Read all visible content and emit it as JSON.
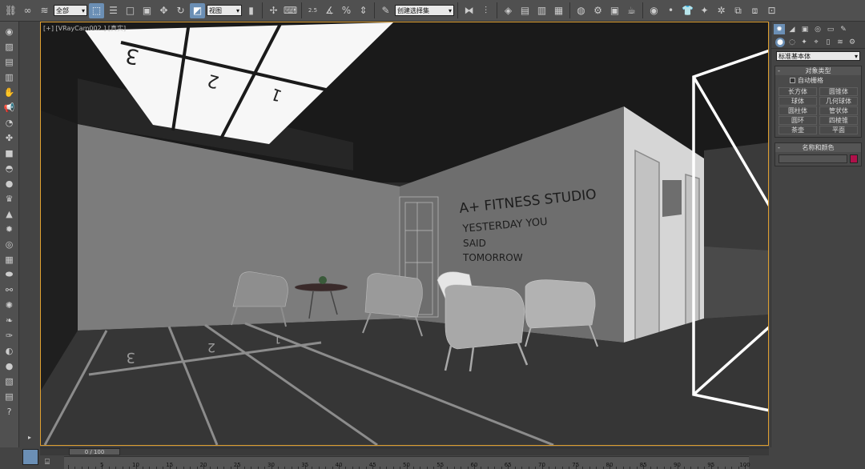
{
  "toolbar": {
    "selection_filter": "全部",
    "reference_coord": "视图",
    "named_selection": "创建选择集",
    "snap_25": "2.5",
    "percent_snap": "%",
    "icons": [
      "link-icon",
      "unlink-icon",
      "bind-spacewarp-icon",
      "select-object-icon",
      "select-by-name-icon",
      "rect-selection-icon",
      "window-crossing-icon",
      "move-icon",
      "rotate-icon",
      "scale-icon",
      "pivot-icon",
      "manipulate-icon",
      "keyboard-shortcut-icon",
      "snap-icon",
      "angle-snap-icon",
      "percent-snap-icon",
      "spinner-snap-icon",
      "edit-named-selection-icon",
      "mirror-icon",
      "align-icon",
      "layer-manager-icon",
      "graphite-icon",
      "curve-editor-icon",
      "schematic-view-icon",
      "material-editor-icon",
      "render-setup-icon",
      "rendered-frame-icon",
      "render-icon",
      "teapot-icon",
      "shirt-icon",
      "gear-icon",
      "render-production-icon"
    ]
  },
  "left_tools": [
    "eye-icon",
    "plane-icon",
    "box-icon",
    "light-icon",
    "sound-icon",
    "camera-icon",
    "helpers-icon",
    "sphere-icon",
    "cylinder-icon",
    "cone-icon",
    "torus-icon",
    "pyramid-icon",
    "sun-icon",
    "disc-icon",
    "atom-icon",
    "bone-icon",
    "particle-icon",
    "fluid-icon",
    "leaf-icon",
    "gear-icon",
    "help-icon"
  ],
  "viewport": {
    "label": "[+] [VRayCam002 ] [真实]",
    "wall_text": [
      "A+ FITNESS STUDIO",
      "YESTERDAY YOU",
      "SAID",
      "TOMORROW"
    ],
    "ceiling_numbers": [
      "3",
      "2",
      "1"
    ],
    "floor_numbers": [
      "3",
      "2",
      "1"
    ]
  },
  "command_panel": {
    "object_type_dropdown": "标准基本体",
    "object_type_header": "对象类型",
    "auto_grid": "自动栅格",
    "objects": [
      "长方体",
      "圆锥体",
      "球体",
      "几何球体",
      "圆柱体",
      "管状体",
      "圆环",
      "四棱锥",
      "茶壶",
      "平面"
    ],
    "name_color_header": "名称和颜色",
    "swatch_color": "#b0104a"
  },
  "timeline": {
    "frame_display": "0 / 100",
    "ticks": [
      "0",
      "5",
      "10",
      "15",
      "20",
      "25",
      "30",
      "35",
      "40",
      "45",
      "50",
      "55",
      "60",
      "65",
      "70",
      "75",
      "80",
      "85",
      "90",
      "95",
      "100"
    ]
  },
  "colors": {
    "accent": "#6b8fb5",
    "viewport_border": "#e0a030"
  }
}
